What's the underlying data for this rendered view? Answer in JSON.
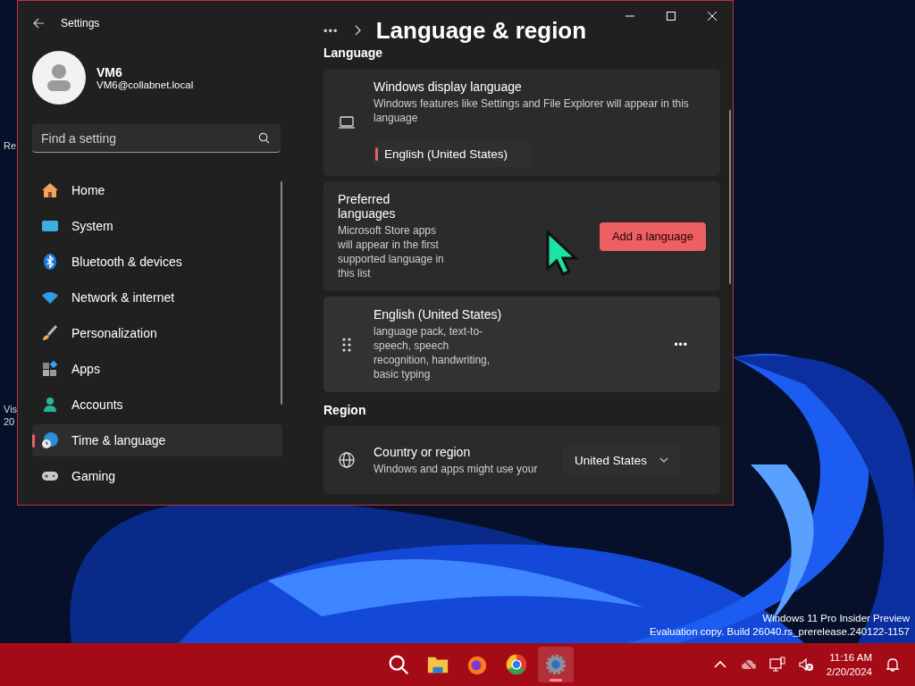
{
  "desktop": {
    "icon_labels": [
      {
        "text": "Re"
      },
      {
        "text": "Vis"
      },
      {
        "text": "20"
      }
    ],
    "watermark": [
      "Windows 11 Pro Insider Preview",
      "Evaluation copy. Build 26040.rs_prerelease.240122-1157"
    ]
  },
  "window": {
    "title": "Settings"
  },
  "account": {
    "name": "VM6",
    "email": "VM6@collabnet.local"
  },
  "search": {
    "placeholder": "Find a setting"
  },
  "sidebar": {
    "items": [
      {
        "label": "Home",
        "kind": "home",
        "selected": false
      },
      {
        "label": "System",
        "kind": "system",
        "selected": false
      },
      {
        "label": "Bluetooth & devices",
        "kind": "bluetooth",
        "selected": false
      },
      {
        "label": "Network & internet",
        "kind": "network",
        "selected": false
      },
      {
        "label": "Personalization",
        "kind": "brush",
        "selected": false
      },
      {
        "label": "Apps",
        "kind": "apps",
        "selected": false
      },
      {
        "label": "Accounts",
        "kind": "accounts",
        "selected": false
      },
      {
        "label": "Time & language",
        "kind": "time",
        "selected": true
      },
      {
        "label": "Gaming",
        "kind": "gaming",
        "selected": false
      }
    ]
  },
  "breadcrumb": {
    "more": "•••",
    "title": "Language & region"
  },
  "sections": [
    {
      "heading": "Language",
      "cards": [
        {
          "kind": "display",
          "title": "Windows display language",
          "description": "Windows features like Settings and File Explorer will appear in this language",
          "value": "English (United States)"
        },
        {
          "kind": "preferred",
          "title": "Preferred languages",
          "description": "Microsoft Store apps will appear in the first supported language in this list",
          "button": "Add a language"
        },
        {
          "kind": "language",
          "title": "English (United States)",
          "description": "language pack, text-to-speech, speech recognition, handwriting, basic typing",
          "more": "•••"
        }
      ]
    },
    {
      "heading": "Region",
      "cards": [
        {
          "kind": "region",
          "title": "Country or region",
          "description": "Windows and apps might use your",
          "value": "United States"
        }
      ]
    }
  ],
  "taskbar": {
    "apps": [
      {
        "kind": "search",
        "selected": false
      },
      {
        "kind": "folder",
        "selected": false
      },
      {
        "kind": "firefox",
        "selected": false
      },
      {
        "kind": "chrome",
        "selected": false
      },
      {
        "kind": "settings",
        "selected": true
      }
    ],
    "time": "11:16 AM",
    "date": "2/20/2024"
  }
}
